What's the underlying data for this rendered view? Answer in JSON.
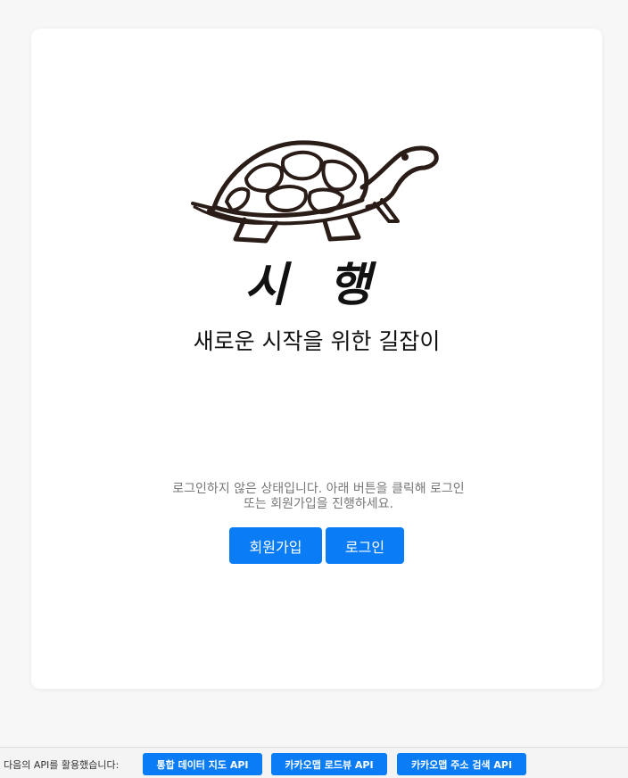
{
  "brand": {
    "title": "시 행",
    "tagline": "새로운 시작을 위한 길잡이",
    "logo_icon": "turtle-icon"
  },
  "auth": {
    "status_line1": "로그인하지 않은 상태입니다. 아래 버튼을 클릭해 로그인",
    "status_line2": "또는 회원가입을 진행하세요.",
    "signup_label": "회원가입",
    "login_label": "로그인"
  },
  "footer": {
    "label": "다음의 API를 활용했습니다:",
    "apis": [
      {
        "label": "통합 데이터 지도 API"
      },
      {
        "label": "카카오맵 로드뷰 API"
      },
      {
        "label": "카카오맵 주소 검색 API"
      }
    ]
  },
  "colors": {
    "accent": "#0a7cf5",
    "background": "#f7f7f7",
    "card": "#ffffff"
  }
}
